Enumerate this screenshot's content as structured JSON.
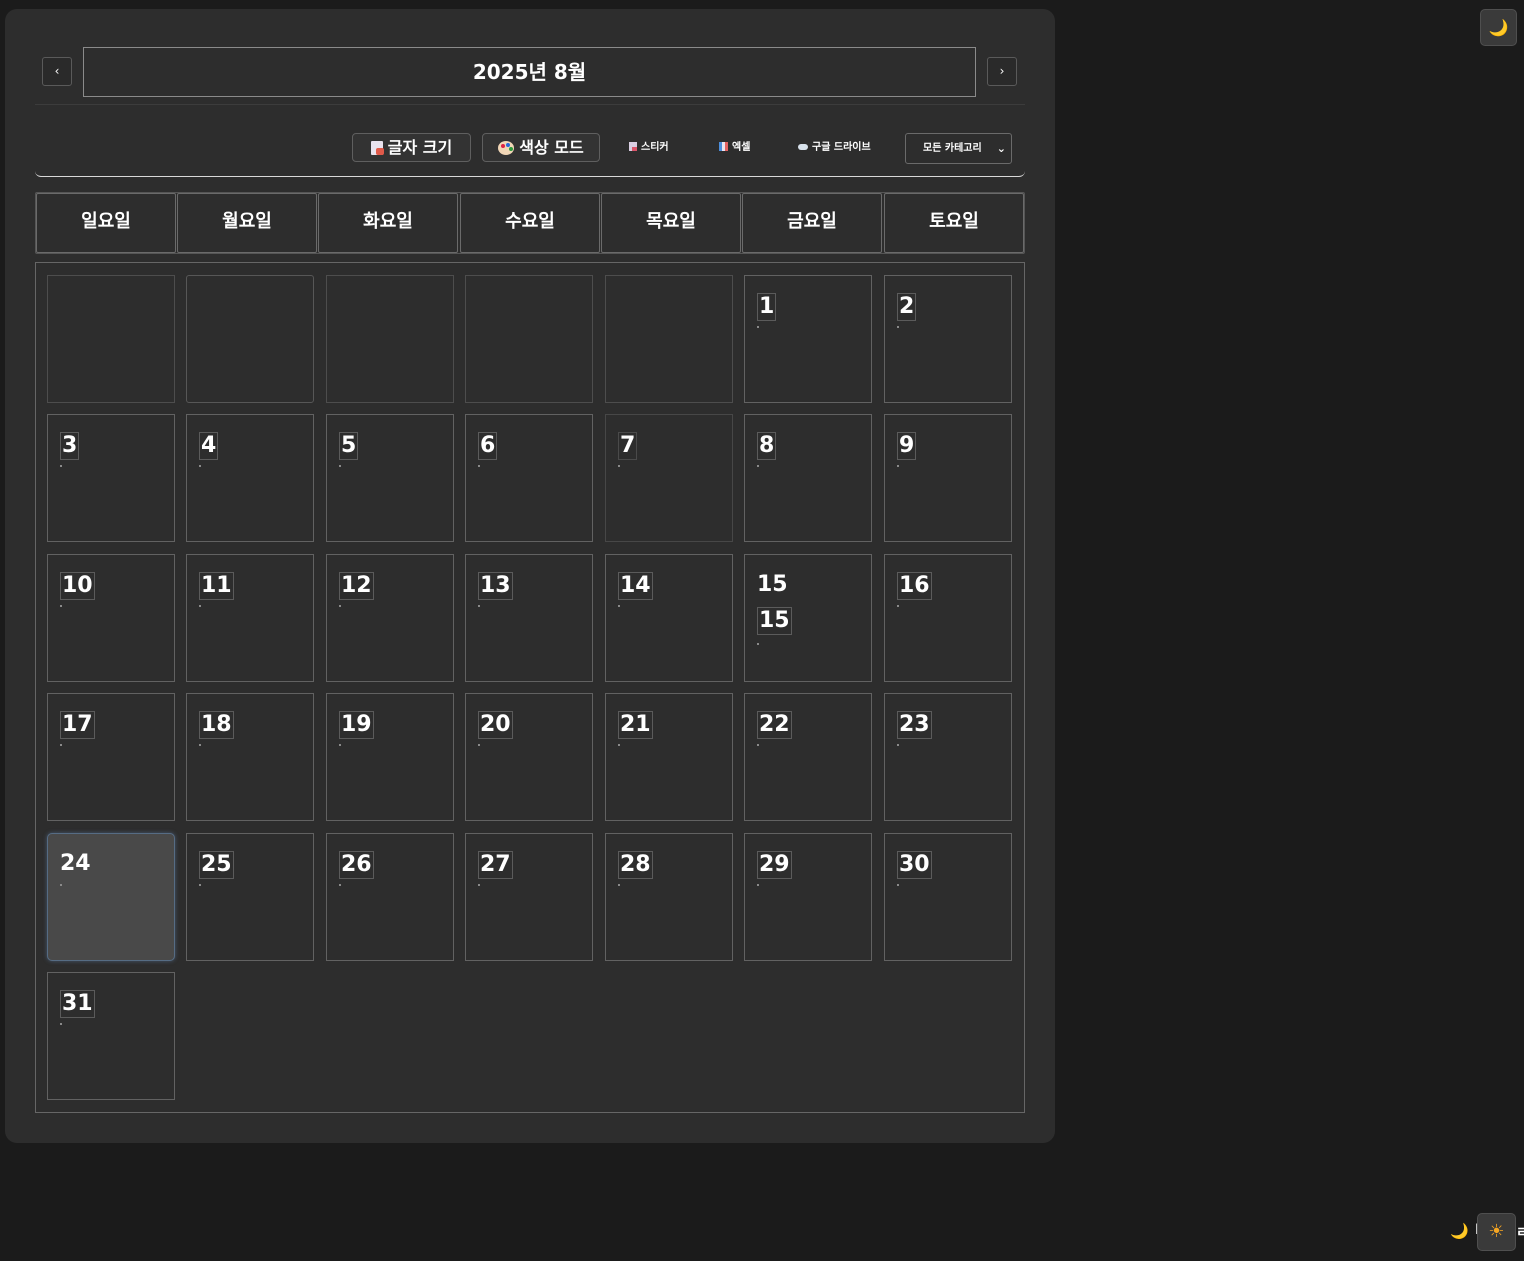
{
  "calendar": {
    "title": "2025년 8월",
    "prev_label": "‹",
    "next_label": "›"
  },
  "toolbar": {
    "font_size_label": "글자 크기",
    "color_mode_label": "색상 모드",
    "sticker_label": "스티커",
    "excel_label": "엑셀",
    "drive_label": "구글 드라이브",
    "category_selected": "모든 카테고리",
    "category_chevron": "⌄"
  },
  "weekdays": [
    "일요일",
    "월요일",
    "화요일",
    "수요일",
    "목요일",
    "금요일",
    "토요일"
  ],
  "days": [
    "1",
    "2",
    "3",
    "4",
    "5",
    "6",
    "7",
    "8",
    "9",
    "10",
    "11",
    "12",
    "13",
    "14",
    "15",
    "16",
    "17",
    "18",
    "19",
    "20",
    "21",
    "22",
    "23",
    "24",
    "25",
    "26",
    "27",
    "28",
    "29",
    "30",
    "31"
  ],
  "day15_extra": "15",
  "floating": {
    "moon_icon": "🌙",
    "sun_icon": "☀",
    "partial_left": "I",
    "partial_right": "ㄹ"
  },
  "colors": {
    "background": "#1b1b1b",
    "panel": "#2d2d2d",
    "today_cell": "#494949"
  }
}
